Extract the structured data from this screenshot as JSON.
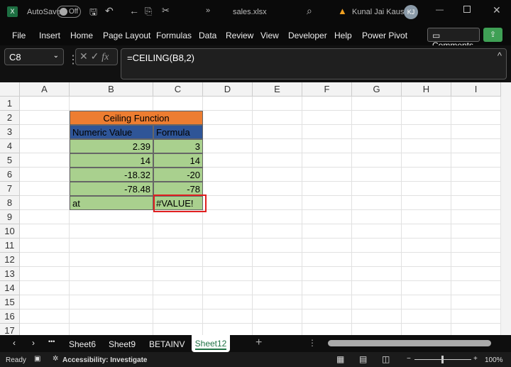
{
  "titlebar": {
    "autosave": "AutoSave",
    "toggle": "Off",
    "filename": "sales.xlsx",
    "user": "Kunal Jai Kaushik",
    "initials": "KJ"
  },
  "ribbon": {
    "menus": [
      "File",
      "Insert",
      "Home",
      "Page Layout",
      "Formulas",
      "Data",
      "Review",
      "View",
      "Developer",
      "Help",
      "Power Pivot"
    ],
    "comments": "Comments"
  },
  "formula_bar": {
    "name_box": "C8",
    "fx": "fx",
    "formula": "=CEILING(B8,2)"
  },
  "columns": [
    "A",
    "B",
    "C",
    "D",
    "E",
    "F",
    "G",
    "H",
    "I"
  ],
  "rows": [
    "1",
    "2",
    "3",
    "4",
    "5",
    "6",
    "7",
    "8",
    "9",
    "10",
    "11",
    "12",
    "13",
    "14",
    "15",
    "16",
    "17"
  ],
  "table": {
    "title": "Ceiling Function",
    "headers": [
      "Numeric Value",
      "Formula"
    ],
    "rows": [
      [
        "2.39",
        "3"
      ],
      [
        "14",
        "14"
      ],
      [
        "-18.32",
        "-20"
      ],
      [
        "-78.48",
        "-78"
      ],
      [
        "at",
        "#VALUE!"
      ]
    ]
  },
  "colors": {
    "title_bg": "#ed7d31",
    "header_bg": "#2f5597",
    "data_bg": "#a9d08e",
    "highlight": "#e02020",
    "accent": "#217346"
  },
  "sheets": {
    "tabs": [
      "Sheet6",
      "Sheet9",
      "BETAINV",
      "Sheet12"
    ],
    "active": "Sheet12",
    "more": "•••"
  },
  "status": {
    "ready": "Ready",
    "accessibility": "Accessibility: Investigate",
    "zoom": "100%"
  }
}
